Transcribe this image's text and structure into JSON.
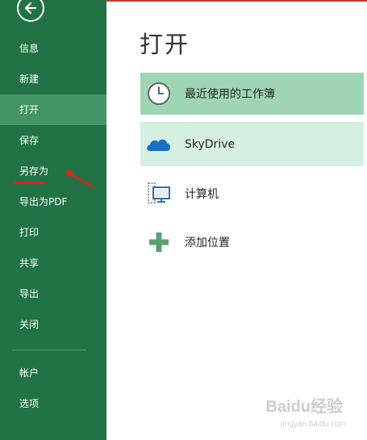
{
  "sidebar": {
    "items": [
      {
        "label": "信息",
        "active": false
      },
      {
        "label": "新建",
        "active": false
      },
      {
        "label": "打开",
        "active": true
      },
      {
        "label": "保存",
        "active": false
      },
      {
        "label": "另存为",
        "active": false
      },
      {
        "label": "导出为PDF",
        "active": false
      },
      {
        "label": "打印",
        "active": false
      },
      {
        "label": "共享",
        "active": false
      },
      {
        "label": "导出",
        "active": false
      },
      {
        "label": "关闭",
        "active": false
      },
      {
        "label": "帐户",
        "active": false
      },
      {
        "label": "选项",
        "active": false
      }
    ],
    "back_icon": "back-arrow-icon"
  },
  "main": {
    "title": "打开",
    "places": [
      {
        "label": "最近使用的工作簿",
        "icon": "clock-icon"
      },
      {
        "label": "SkyDrive",
        "icon": "cloud-icon"
      },
      {
        "label": "计算机",
        "icon": "computer-icon"
      },
      {
        "label": "添加位置",
        "icon": "plus-icon"
      }
    ]
  },
  "annotation": {
    "color": "#e0211b",
    "target": "另存为"
  },
  "watermark": {
    "text": "Baidu经验",
    "sub": "jingyan.baidu.com"
  },
  "colors": {
    "sidebar_bg": "#217346",
    "sidebar_active": "#439467",
    "recent_highlight": "#9fd5b4",
    "skydrive_highlight": "#d5efe0"
  }
}
